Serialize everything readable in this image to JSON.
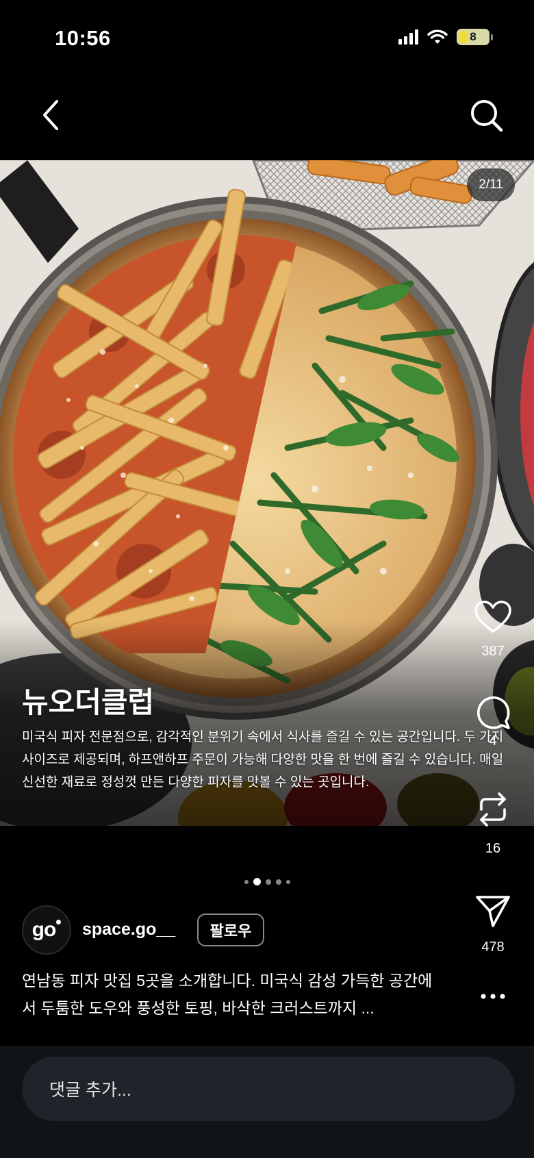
{
  "status_bar": {
    "time": "10:56",
    "battery": "8"
  },
  "nav": {
    "back_icon": "chevron-left-icon",
    "search_icon": "search-icon"
  },
  "post": {
    "page_counter": "2/11",
    "place_title": "뉴오더클럽",
    "place_description": "미국식 피자 전문점으로, 감각적인 분위기 속에서 식사를 즐길 수 있는 공간입니다. 두 가지 사이즈로 제공되며, 하프앤하프 주문이 가능해 다양한 맛을 한 번에 즐길 수 있습니다. 매일 신선한 재료로 정성껏 만든 다양한 피자를 맛볼 수 있는 곳입니다.",
    "carousel": {
      "total_dots": 5,
      "active_index": 1
    }
  },
  "actions": {
    "like_count": "387",
    "comment_count": "4",
    "repost_count": "16",
    "share_count": "478"
  },
  "profile": {
    "avatar_text": "go",
    "username": "space.go__",
    "follow_label": "팔로우"
  },
  "caption": "연남동 피자 맛집 5곳을 소개합니다. 미국식 감성 가득한 공간에서 두툼한 도우와 풍성한 토핑, 바삭한 크러스트까지 ...",
  "comment": {
    "placeholder": "댓글 추가..."
  },
  "colors": {
    "background": "#000000",
    "comment_bar": "#101318",
    "input": "#1f232a"
  }
}
